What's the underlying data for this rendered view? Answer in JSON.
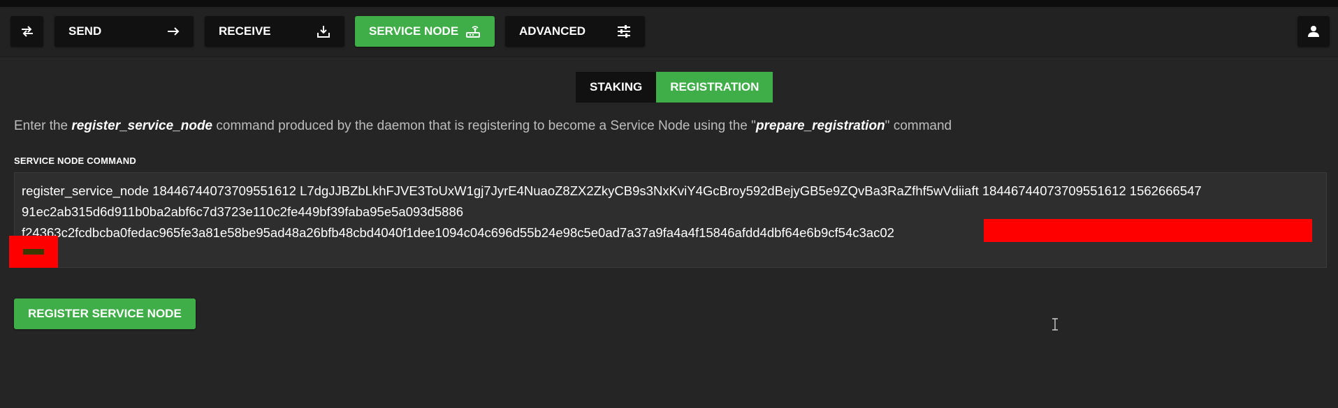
{
  "toolbar": {
    "send_label": "SEND",
    "receive_label": "RECEIVE",
    "service_node_label": "SERVICE NODE",
    "advanced_label": "ADVANCED",
    "icons": {
      "swap": "swap-arrows-icon",
      "send": "arrow-right-icon",
      "receive": "download-icon",
      "service_node": "router-icon",
      "advanced": "sliders-icon",
      "account": "user-icon"
    }
  },
  "tabs": [
    {
      "label": "STAKING",
      "active": false
    },
    {
      "label": "REGISTRATION",
      "active": true
    }
  ],
  "instructions": {
    "part1": "Enter the ",
    "cmd1": "register_service_node",
    "part2": " command produced by the daemon that is registering to become a Service Node using the \"",
    "cmd2": "prepare_registration",
    "part3": "\" command"
  },
  "command_field": {
    "label": "SERVICE NODE COMMAND",
    "lines": [
      "register_service_node 18446744073709551612 L7dgJJBZbLkhFJVE3ToUxW1gj7JyrE4NuaoZ8ZX2ZkyCB9s3NxKviY4GcBroy592dBejyGB5e9ZQvBa3RaZfhf5wVdiiaft 18446744073709551612 1562666547",
      "91ec2ab315d6d911b0ba2abf6c7d3723e110c2fe449bf39faba95e5a093d5886",
      "f24363c2fcdbcba0fedac965fe3a81e58be95ad48a26bfb48cbd4040f1dee1094c04c696d55b24e98c5e0ad7a37a9fa4a4f15846afdd4dbf64e6b9cf54c3ac02"
    ]
  },
  "register_button_label": "REGISTER SERVICE NODE",
  "colors": {
    "accent": "#3fae49",
    "background": "#252525",
    "button_dark": "#111111",
    "redaction": "#ff0000"
  }
}
